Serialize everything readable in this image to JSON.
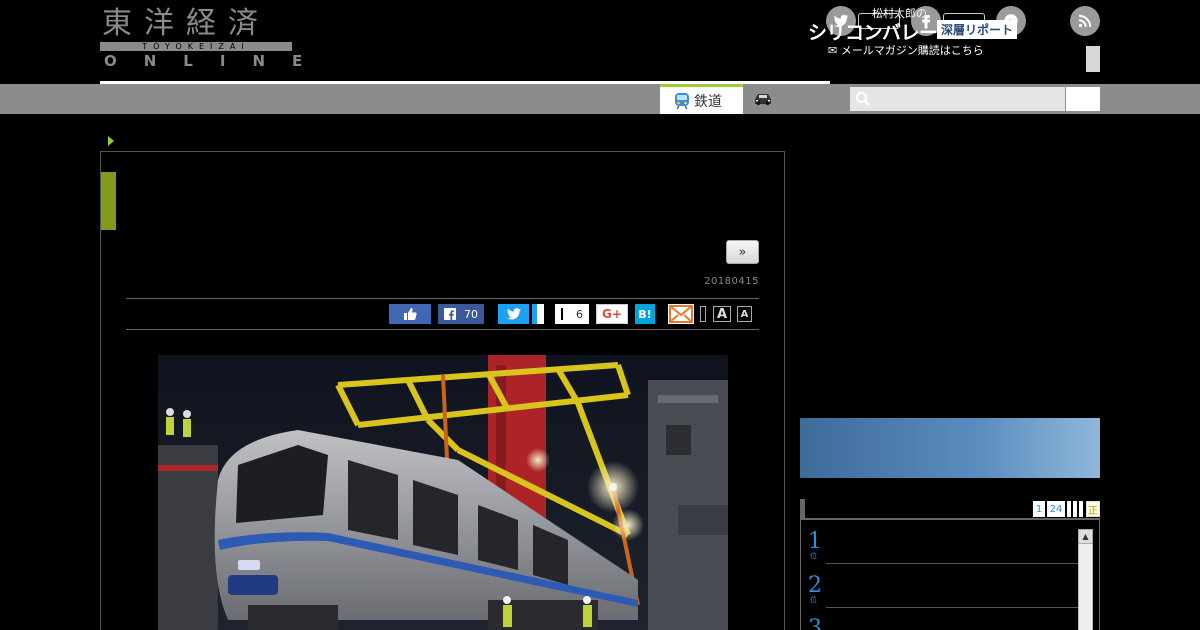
{
  "logo": {
    "kanji": "東洋経済",
    "romaji": "TOYOKEIZAI",
    "online": "ONLINE"
  },
  "nav": {
    "active_tab": "鉄道",
    "search_placeholder": ""
  },
  "article": {
    "next_label": "»",
    "date": "20180415"
  },
  "share": {
    "fb_count": "70",
    "count": "6",
    "gplus_label": "G+",
    "hatena_label": "B!",
    "font_large": "A",
    "font_small": "A"
  },
  "banner": {
    "small_text": "松村太郎の",
    "big_text": "シリコンバレー",
    "tag_text": "深層リポート",
    "mail_text": "メールマガジン購読はこちら"
  },
  "ranking": {
    "tabs": [
      "1",
      "24",
      "",
      "",
      "",
      "",
      "正"
    ],
    "items": [
      {
        "num": "1",
        "sub": "位"
      },
      {
        "num": "2",
        "sub": "位"
      },
      {
        "num": "3",
        "sub": ""
      }
    ]
  },
  "colors": {
    "accent_green": "#9acd32",
    "nav_gray": "#8c8c8c",
    "rank_blue": "#2f8fd8"
  }
}
